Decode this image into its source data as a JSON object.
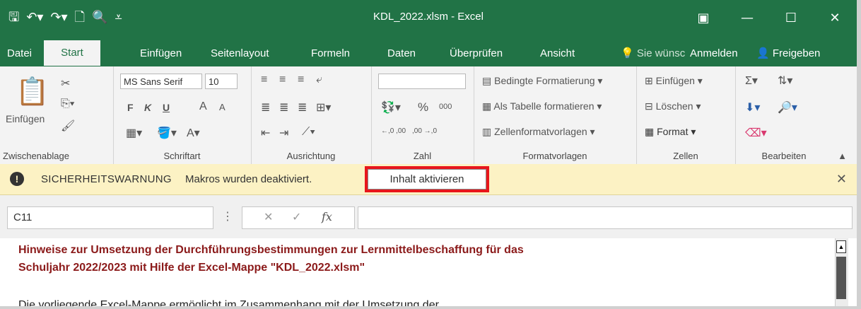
{
  "window": {
    "title": "KDL_2022.xlsm - Excel",
    "qat": [
      "save-icon",
      "undo-icon",
      "redo-icon",
      "new-icon",
      "print-preview-icon",
      "customize-icon"
    ],
    "buttons": [
      "ribbon-display-icon",
      "minimize-icon",
      "maximize-icon",
      "close-icon"
    ]
  },
  "tabs": {
    "items": [
      "Datei",
      "Start",
      "Einfügen",
      "Seitenlayout",
      "Formeln",
      "Daten",
      "Überprüfen",
      "Ansicht"
    ],
    "active": "Start",
    "tellme": "Sie wünsc",
    "signin": "Anmelden",
    "share": "Freigeben"
  },
  "ribbon": {
    "clipboard": {
      "label": "Zwischenablage",
      "paste": "Einfügen"
    },
    "font": {
      "label": "Schriftart",
      "family": "MS Sans Serif",
      "size": "10",
      "bold": "F",
      "italic": "K",
      "underline": "U",
      "grow": "A",
      "shrink": "A"
    },
    "alignment": {
      "label": "Ausrichtung"
    },
    "number": {
      "label": "Zahl",
      "percent": "%",
      "thousands": "000",
      "inc": "←,0 ,00",
      "dec": ",00 →,0"
    },
    "styles": {
      "label": "Formatvorlagen",
      "conditional": "Bedingte Formatierung",
      "table": "Als Tabelle formatieren",
      "cell": "Zellenformatvorlagen"
    },
    "cells": {
      "label": "Zellen",
      "insert": "Einfügen",
      "delete": "Löschen",
      "format": "Format"
    },
    "editing": {
      "label": "Bearbeiten"
    }
  },
  "security": {
    "title": "SICHERHEITSWARNUNG",
    "message": "Makros wurden deaktiviert.",
    "button": "Inhalt aktivieren",
    "highlight_color": "#e8161b"
  },
  "formula": {
    "namebox": "C11",
    "fx": "fx"
  },
  "sheet": {
    "heading_line1": "Hinweise zur Umsetzung der Durchführungsbestimmungen zur Lernmittelbeschaffung für das",
    "heading_line2": "Schuljahr 2022/2023 mit Hilfe der Excel-Mappe \"KDL_2022.xlsm\"",
    "paragraph": "Die vorliegende Excel-Mappe ermöglicht im Zusammenhang mit der Umsetzung der"
  },
  "colors": {
    "excel_green": "#217346",
    "warning_bg": "#fcf2c4",
    "heading": "#8b1a1a"
  }
}
